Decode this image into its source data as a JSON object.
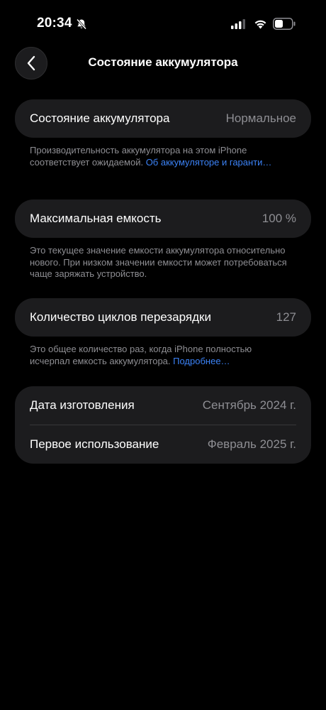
{
  "status_bar": {
    "time": "20:34"
  },
  "nav": {
    "title": "Состояние аккумулятора"
  },
  "battery_health": {
    "label": "Состояние аккумулятора",
    "value": "Нормальное",
    "footnote_text": "Производительность аккумулятора на этом iPhone соответствует ожидаемой. ",
    "footnote_link": "Об аккумуляторе и гаранти…"
  },
  "max_capacity": {
    "label": "Максимальная емкость",
    "value": "100 %",
    "footnote_text": "Это текущее значение емкости аккумулятора относительно нового. При низком значении емкости может потребоваться чаще заряжать устройство."
  },
  "cycle_count": {
    "label": "Количество циклов перезарядки",
    "value": "127",
    "footnote_text": "Это общее количество раз, когда iPhone полностью исчерпал емкость аккумулятора. ",
    "footnote_link": "Подробнее…"
  },
  "dates": {
    "manufacture_label": "Дата изготовления",
    "manufacture_value": "Сентябрь 2024 г.",
    "first_use_label": "Первое использование",
    "first_use_value": "Февраль 2025 г."
  },
  "colors": {
    "background": "#000000",
    "card": "#1c1c1e",
    "secondary_text": "#8e8e93",
    "link": "#3b82f6"
  }
}
